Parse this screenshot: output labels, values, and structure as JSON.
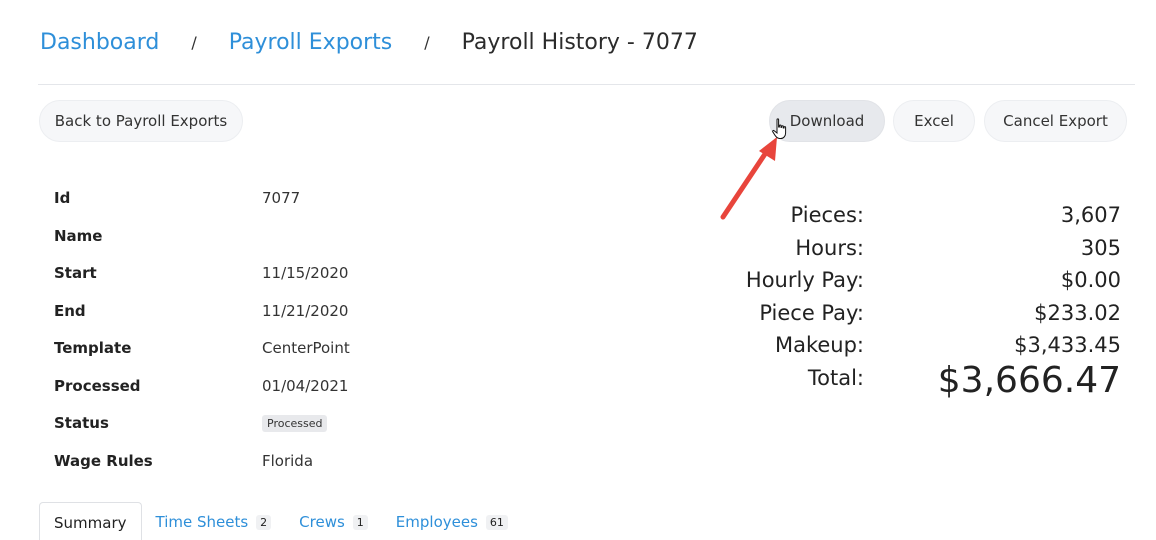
{
  "breadcrumb": {
    "dashboard": "Dashboard",
    "separator": "/",
    "payroll_exports": "Payroll Exports",
    "current": "Payroll History - 7077"
  },
  "toolbar": {
    "back_label": "Back to Payroll Exports",
    "download_label": "Download",
    "excel_label": "Excel",
    "cancel_label": "Cancel Export"
  },
  "details": {
    "id_label": "Id",
    "id_value": "7077",
    "name_label": "Name",
    "name_value": "",
    "start_label": "Start",
    "start_value": "11/15/2020",
    "end_label": "End",
    "end_value": "11/21/2020",
    "template_label": "Template",
    "template_value": "CenterPoint",
    "processed_label": "Processed",
    "processed_value": "01/04/2021",
    "status_label": "Status",
    "status_value": "Processed",
    "wage_rules_label": "Wage Rules",
    "wage_rules_value": "Florida"
  },
  "totals": {
    "pieces_label": "Pieces:",
    "pieces_value": "3,607",
    "hours_label": "Hours:",
    "hours_value": "305",
    "hourly_pay_label": "Hourly Pay:",
    "hourly_pay_value": "$0.00",
    "piece_pay_label": "Piece Pay:",
    "piece_pay_value": "$233.02",
    "makeup_label": "Makeup:",
    "makeup_value": "$3,433.45",
    "total_label": "Total:",
    "total_value": "$3,666.47"
  },
  "tabs": {
    "summary": "Summary",
    "time_sheets": "Time Sheets",
    "time_sheets_count": "2",
    "crews": "Crews",
    "crews_count": "1",
    "employees": "Employees",
    "employees_count": "61"
  },
  "colors": {
    "link": "#2e8fd9",
    "annotation_arrow": "#e8453c"
  },
  "icons": {
    "pointer": "hand-pointer-icon",
    "annotation": "red-arrow-icon"
  }
}
